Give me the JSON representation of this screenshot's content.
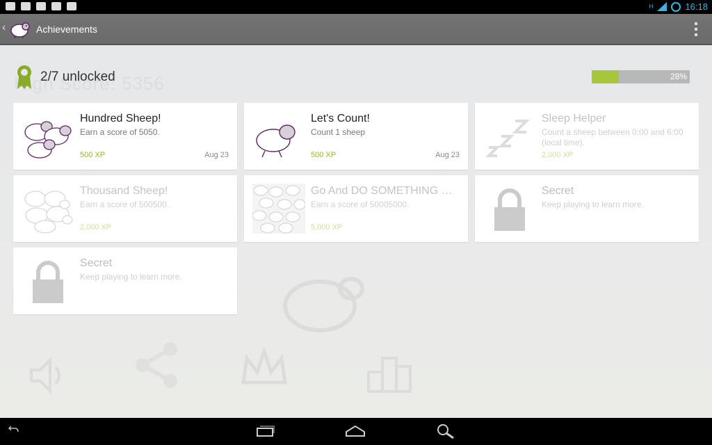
{
  "status_bar": {
    "time": "16:18",
    "network_label": "H"
  },
  "action_bar": {
    "title": "Achievements"
  },
  "background": {
    "score_text": "High Score: 5356"
  },
  "summary": {
    "unlocked_text": "2/7 unlocked",
    "progress_percent": 28,
    "progress_label": "28%",
    "progress_color": "#a8c63a"
  },
  "achievements": [
    {
      "title": "Hundred Sheep!",
      "description": "Earn a score of 5050.",
      "xp": "500 XP",
      "date": "Aug 23",
      "state": "unlocked",
      "icon": "three-sheep-icon"
    },
    {
      "title": "Let's Count!",
      "description": "Count 1 sheep",
      "xp": "500 XP",
      "date": "Aug 23",
      "state": "unlocked",
      "icon": "sheep-icon"
    },
    {
      "title": "Sleep Helper",
      "description": "Count a sheep between 0:00 and 6:00 (local time).",
      "xp": "2,000 XP",
      "date": "",
      "state": "locked",
      "icon": "zzz-icon"
    },
    {
      "title": "Thousand Sheep!",
      "description": "Earn a score of 500500.",
      "xp": "2,000 XP",
      "date": "",
      "state": "locked",
      "icon": "sheep-flock-icon"
    },
    {
      "title": "Go And DO SOMETHING US...",
      "description": "Earn a score of 50005000.",
      "xp": "5,000 XP",
      "date": "",
      "state": "locked",
      "icon": "sheep-crowd-icon"
    },
    {
      "title": "Secret",
      "description": "Keep playing to learn more.",
      "xp": "",
      "date": "",
      "state": "secret",
      "icon": "lock-icon"
    },
    {
      "title": "Secret",
      "description": "Keep playing to learn more.",
      "xp": "",
      "date": "",
      "state": "secret",
      "icon": "lock-icon"
    }
  ]
}
